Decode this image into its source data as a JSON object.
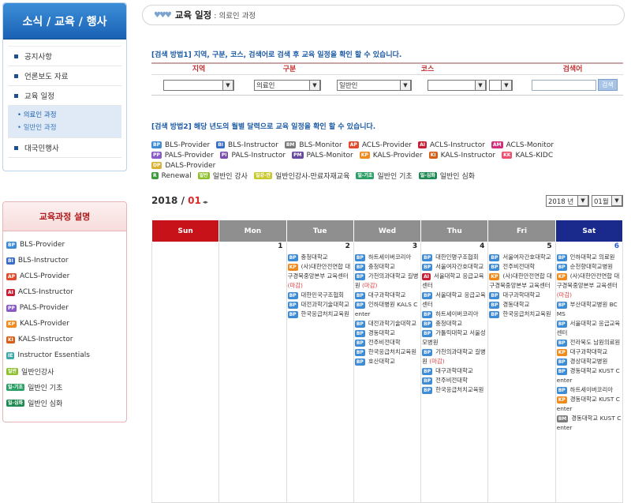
{
  "sidebar": {
    "header": "소식 / 교육 / 행사",
    "menu": [
      {
        "label": "공지사항"
      },
      {
        "label": "언론보도 자료"
      },
      {
        "label": "교육 일정"
      }
    ],
    "submenu": [
      {
        "label": "• 의료인 과정"
      },
      {
        "label": "• 일반인 과정"
      }
    ],
    "last_menu": {
      "label": "대국민행사"
    },
    "course_header": "교육과정 설명",
    "courses": [
      {
        "badge": "BP",
        "label": "BLS-Provider",
        "color": "#3f8cd6"
      },
      {
        "badge": "BI",
        "label": "BLS-Instructor",
        "color": "#3a6cc8"
      },
      {
        "badge": "AP",
        "label": "ACLS-Provider",
        "color": "#e24a2c"
      },
      {
        "badge": "AI",
        "label": "ACLS-Instructor",
        "color": "#c81e34"
      },
      {
        "badge": "PP",
        "label": "PALS-Provider",
        "color": "#8a5bc7"
      },
      {
        "badge": "KP",
        "label": "KALS-Provider",
        "color": "#f08a1c"
      },
      {
        "badge": "KI",
        "label": "KALS-Instructor",
        "color": "#d75e17"
      },
      {
        "badge": "IE",
        "label": "Instructor Essentials",
        "color": "#3fa8a8"
      },
      {
        "badge": "일반",
        "label": "일반인강사",
        "color": "#8cbf2a"
      },
      {
        "badge": "일-기초",
        "label": "일반인 기초",
        "color": "#2c9f66"
      },
      {
        "badge": "일-심화",
        "label": "일반인 심화",
        "color": "#1f8a52"
      }
    ]
  },
  "page": {
    "title": "교육 일정",
    "subtitle": ": 의료인 과정"
  },
  "method1": {
    "title": "[검색 방법1] 지역, 구분, 코스, 검색어로 검색 후 교육 일정을 확인 할 수 있습니다.",
    "headers": {
      "region": "지역",
      "type": "구분",
      "course": "코스",
      "keyword": "검색어"
    },
    "region_value": "",
    "type_value": "의료인",
    "course_value1": "일반인",
    "course_value2": "",
    "course_value3": "",
    "search_button": "검색"
  },
  "method2": {
    "title": "[검색 방법2] 해당 년도의 월별 달력으로 교육 일정을 확인 할 수 있습니다."
  },
  "legend": [
    [
      {
        "b": "BP",
        "t": "BLS-Provider",
        "c": "#3f8cd6"
      },
      {
        "b": "BI",
        "t": "BLS-Instructor",
        "c": "#3a6cc8"
      },
      {
        "b": "BM",
        "t": "BLS-Monitor",
        "c": "#7b7b7b"
      },
      {
        "b": "AP",
        "t": "ACLS-Provider",
        "c": "#e24a2c"
      },
      {
        "b": "AI",
        "t": "ACLS-Instructor",
        "c": "#c81e34"
      },
      {
        "b": "AM",
        "t": "ACLS-Monitor",
        "c": "#d12e7b"
      }
    ],
    [
      {
        "b": "PP",
        "t": "PALS-Provider",
        "c": "#8a5bc7"
      },
      {
        "b": "PI",
        "t": "PALS-Instructor",
        "c": "#7c4ab0"
      },
      {
        "b": "PM",
        "t": "PALS-Monitor",
        "c": "#6a4a9e"
      },
      {
        "b": "KP",
        "t": "KALS-Provider",
        "c": "#f08a1c"
      },
      {
        "b": "KI",
        "t": "KALS-Instructor",
        "c": "#d75e17"
      },
      {
        "b": "KK",
        "t": "KALS-KIDC",
        "c": "#ee4d6e"
      }
    ],
    [
      {
        "b": "DP",
        "t": "DALS-Provider",
        "c": "#d9b233"
      }
    ],
    [
      {
        "b": "R",
        "t": "Renewal",
        "c": "#3e9a3a"
      },
      {
        "b": "일반",
        "t": "일반인 강사",
        "c": "#8cbf2a"
      },
      {
        "b": "일강-만",
        "t": "일반인강사-만료자재교육",
        "c": "#c8c82c"
      },
      {
        "b": "일-기초",
        "t": "일반인 기초",
        "c": "#2c9f66"
      },
      {
        "b": "일-심화",
        "t": "일반인 심화",
        "c": "#1f8a52"
      }
    ]
  ],
  "calendar": {
    "year": "2018 /",
    "month": "01",
    "nav": "◂▸",
    "year_select": "2018 년",
    "month_select": "01월",
    "days": [
      {
        "name": "Sun",
        "color": "#c8121a"
      },
      {
        "name": "Mon",
        "color": "#8f8f8f"
      },
      {
        "name": "Tue",
        "color": "#8f8f8f"
      },
      {
        "name": "Wed",
        "color": "#8f8f8f"
      },
      {
        "name": "Thu",
        "color": "#8f8f8f"
      },
      {
        "name": "Fri",
        "color": "#8f8f8f"
      },
      {
        "name": "Sat",
        "color": "#1a2a8c"
      }
    ],
    "dates": [
      "",
      "1",
      "2",
      "3",
      "4",
      "5",
      "6"
    ],
    "date6_color": "#2a5bd7",
    "events": [
      [],
      [],
      [
        {
          "b": "BP",
          "c": "#3f8cd6",
          "t": "충청대학교"
        },
        {
          "b": "KP",
          "c": "#f08a1c",
          "t": "(사)대한안전연합 대구경북중앙본부 교육센터",
          "m": "(마감)"
        },
        {
          "b": "BP",
          "c": "#3f8cd6",
          "t": "대한민국구조협회"
        },
        {
          "b": "BP",
          "c": "#3f8cd6",
          "t": "대전과학기술대학교"
        },
        {
          "b": "BP",
          "c": "#3f8cd6",
          "t": "한국응급처치교육원"
        }
      ],
      [
        {
          "b": "BP",
          "c": "#3f8cd6",
          "t": "하트세이버코리아"
        },
        {
          "b": "BP",
          "c": "#3f8cd6",
          "t": "충청대학교"
        },
        {
          "b": "BP",
          "c": "#3f8cd6",
          "t": "가천의과대학교 길병원",
          "m": "(마감)"
        },
        {
          "b": "BP",
          "c": "#3f8cd6",
          "t": "대구과학대학교"
        },
        {
          "b": "BP",
          "c": "#3f8cd6",
          "t": "인하대병원 KALS Center"
        },
        {
          "b": "BP",
          "c": "#3f8cd6",
          "t": "대전과학기술대학교"
        },
        {
          "b": "BP",
          "c": "#3f8cd6",
          "t": "경동대학교"
        },
        {
          "b": "BP",
          "c": "#3f8cd6",
          "t": "전주비전대학"
        },
        {
          "b": "BP",
          "c": "#3f8cd6",
          "t": "한국응급처치교육원"
        },
        {
          "b": "BP",
          "c": "#3f8cd6",
          "t": "호산대학교"
        }
      ],
      [
        {
          "b": "BP",
          "c": "#3f8cd6",
          "t": "대한인명구조협회"
        },
        {
          "b": "BP",
          "c": "#3f8cd6",
          "t": "서울여자간호대학교"
        },
        {
          "b": "AI",
          "c": "#c81e34",
          "t": "서울대학교 응급교육센터"
        },
        {
          "b": "BP",
          "c": "#3f8cd6",
          "t": "서울대학교 응급교육센터"
        },
        {
          "b": "BP",
          "c": "#3f8cd6",
          "t": "하트세이버코리아"
        },
        {
          "b": "BP",
          "c": "#3f8cd6",
          "t": "충청대학교"
        },
        {
          "b": "BP",
          "c": "#3f8cd6",
          "t": "가톨릭대학교 서울성모병원"
        },
        {
          "b": "BP",
          "c": "#3f8cd6",
          "t": "가천의과대학교 길병원",
          "m": "(마감)"
        },
        {
          "b": "BP",
          "c": "#3f8cd6",
          "t": "대구과학대학교"
        },
        {
          "b": "BP",
          "c": "#3f8cd6",
          "t": "전주비전대학"
        },
        {
          "b": "BP",
          "c": "#3f8cd6",
          "t": "한국응급처치교육원"
        }
      ],
      [
        {
          "b": "BP",
          "c": "#3f8cd6",
          "t": "서울여자간호대학교"
        },
        {
          "b": "BP",
          "c": "#3f8cd6",
          "t": "전주비전대학"
        },
        {
          "b": "KP",
          "c": "#f08a1c",
          "t": "(사)대한안전연합 대구경북중앙본부 교육센터"
        },
        {
          "b": "BP",
          "c": "#3f8cd6",
          "t": "대구과학대학교"
        },
        {
          "b": "BP",
          "c": "#3f8cd6",
          "t": "경동대학교"
        },
        {
          "b": "BP",
          "c": "#3f8cd6",
          "t": "한국응급처치교육원"
        }
      ],
      [
        {
          "b": "BP",
          "c": "#3f8cd6",
          "t": "인하대학교 의료원"
        },
        {
          "b": "BP",
          "c": "#3f8cd6",
          "t": "순천향대학교병원"
        },
        {
          "b": "KP",
          "c": "#f08a1c",
          "t": "(사)대한안전연합 대구경북중앙본부 교육센터",
          "m": "(마감)"
        },
        {
          "b": "BP",
          "c": "#3f8cd6",
          "t": "부산대학교병원 BCMS"
        },
        {
          "b": "BP",
          "c": "#3f8cd6",
          "t": "서울대학교 응급교육센터"
        },
        {
          "b": "BP",
          "c": "#3f8cd6",
          "t": "전라북도 남원의료원"
        },
        {
          "b": "KP",
          "c": "#f08a1c",
          "t": "대구과학대학교"
        },
        {
          "b": "BP",
          "c": "#3f8cd6",
          "t": "경상대학교병원"
        },
        {
          "b": "BP",
          "c": "#3f8cd6",
          "t": "경동대학교 KUST Center"
        },
        {
          "b": "BP",
          "c": "#3f8cd6",
          "t": "하트세이버코리아"
        },
        {
          "b": "KP",
          "c": "#f08a1c",
          "t": "경동대학교 KUST Center"
        },
        {
          "b": "BM",
          "c": "#7b7b7b",
          "t": "경동대학교 KUST Center"
        }
      ]
    ]
  }
}
